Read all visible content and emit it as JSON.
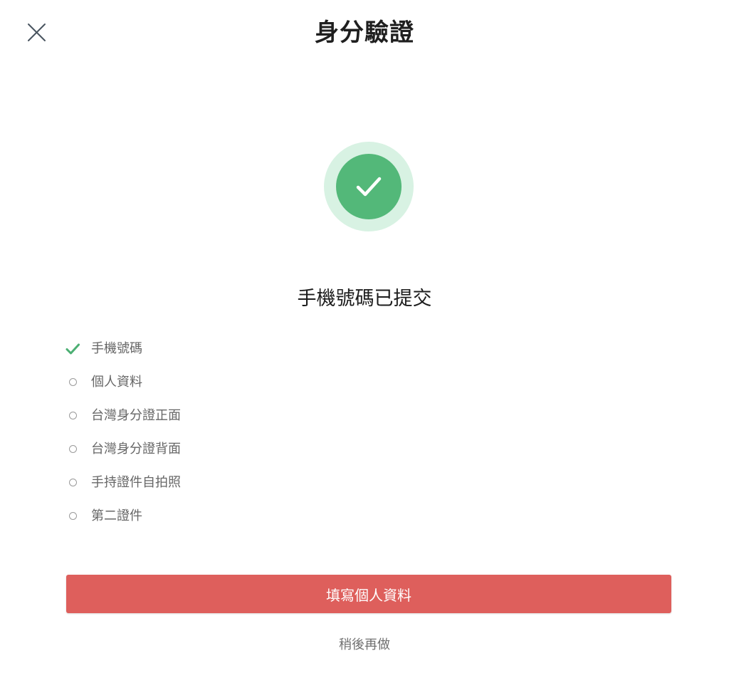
{
  "header": {
    "title": "身分驗證",
    "close_icon": "close-icon"
  },
  "status": {
    "icon": "checkmark-icon",
    "message": "手機號碼已提交",
    "colors": {
      "badge_outer": "#d8f2e3",
      "badge_inner": "#53b879"
    }
  },
  "steps": [
    {
      "label": "手機號碼",
      "completed": true
    },
    {
      "label": "個人資料",
      "completed": false
    },
    {
      "label": "台灣身分證正面",
      "completed": false
    },
    {
      "label": "台灣身分證背面",
      "completed": false
    },
    {
      "label": "手持證件自拍照",
      "completed": false
    },
    {
      "label": "第二證件",
      "completed": false
    }
  ],
  "actions": {
    "primary_label": "填寫個人資料",
    "primary_color": "#de5f5c",
    "secondary_label": "稍後再做"
  }
}
